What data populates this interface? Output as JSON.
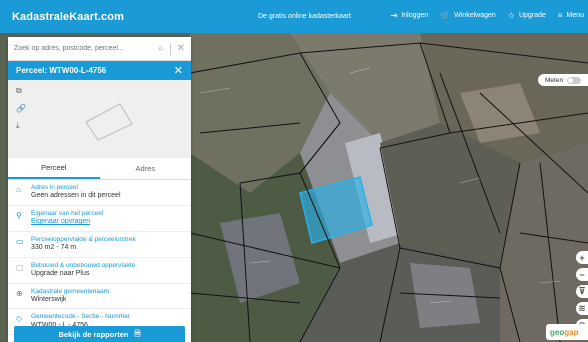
{
  "header": {
    "brand": "KadastraleKaart.com",
    "tagline": "De gratis online kadasterkaart",
    "nav": [
      {
        "label": "Inloggen",
        "icon": "login-icon"
      },
      {
        "label": "Winkelwagen",
        "icon": "cart-icon"
      },
      {
        "label": "Upgrade",
        "icon": "star-icon"
      },
      {
        "label": "Menu",
        "icon": "menu-icon"
      }
    ],
    "background": "#1a9ad6"
  },
  "search": {
    "placeholder": "Zoek op adres, postcode, perceel..."
  },
  "parcel": {
    "title": "Perceel: WTW00-L-4756"
  },
  "tabs": [
    "Perceel",
    "Adres"
  ],
  "details": [
    {
      "label": "Adres in perceel",
      "value": "Geen adressen in dit perceel",
      "icon": "home-icon"
    },
    {
      "label": "Eigenaar van het perceel",
      "value": "Eigenaar opvragen",
      "icon": "user-icon",
      "link": true
    },
    {
      "label": "Perceeloppervlakte & perceelomtrek",
      "value": "330 m2 - 74 m",
      "icon": "area-icon"
    },
    {
      "label": "Bebouwd & onbebouwd oppervlakte",
      "value": "Upgrade naar Plus",
      "icon": "building-icon"
    },
    {
      "label": "Kadastrale gemeentenaam",
      "value": "Winterswijk",
      "icon": "map-icon"
    },
    {
      "label": "Gemeentecode - Sectie - Nummer",
      "value": "WTW00 - L - 4756",
      "icon": "tag-icon"
    }
  ],
  "report_button": "Bekijk de rapporten",
  "measure": {
    "label": "Meten"
  },
  "logo": {
    "part1": "geo",
    "part2": "gap"
  },
  "colors": {
    "accent": "#1a9ad6",
    "selection": "#2ab0e6"
  }
}
